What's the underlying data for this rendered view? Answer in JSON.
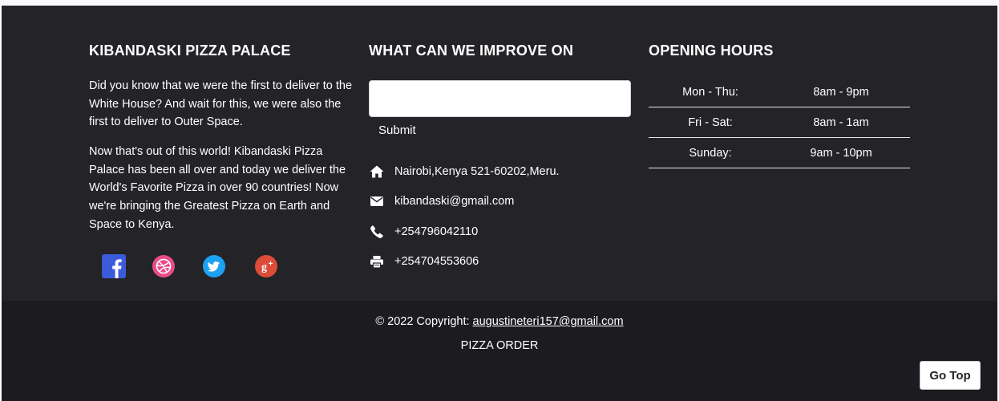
{
  "about": {
    "title": "KIBANDASKI PIZZA PALACE",
    "para1": "Did you know that we were the first to deliver to the White House? And wait for this, we were also the first to deliver to Outer Space.",
    "para2": "Now that's out of this world! Kibandaski Pizza Palace has been all over and today we deliver the World's Favorite Pizza in over 90 countries! Now we're bringing the Greatest Pizza on Earth and Space to Kenya.",
    "social": [
      {
        "icon": "facebook-icon",
        "color": "#3b5bdb"
      },
      {
        "icon": "dribbble-icon",
        "color": "#ea4c89"
      },
      {
        "icon": "twitter-icon",
        "color": "#1da1f2"
      },
      {
        "icon": "google-plus-icon",
        "color": "#dd4b39"
      }
    ]
  },
  "feedback": {
    "title": "WHAT CAN WE IMPROVE ON",
    "input_value": "",
    "submit_label": "Submit",
    "contacts": [
      {
        "icon": "home-icon",
        "text": "Nairobi,Kenya 521-60202,Meru."
      },
      {
        "icon": "envelope-icon",
        "text": "kibandaski@gmail.com"
      },
      {
        "icon": "phone-icon",
        "text": "+254796042110"
      },
      {
        "icon": "printer-icon",
        "text": "+254704553606"
      }
    ]
  },
  "hours": {
    "title": "OPENING HOURS",
    "rows": [
      {
        "day": "Mon - Thu:",
        "time": "8am - 9pm"
      },
      {
        "day": "Fri - Sat:",
        "time": "8am - 1am"
      },
      {
        "day": "Sunday:",
        "time": "9am - 10pm"
      }
    ]
  },
  "bottom": {
    "copyright_prefix": "© 2022 Copyright: ",
    "copyright_email": "augustineteri157@gmail.com",
    "brand": "PIZZA ORDER",
    "go_top_label": "Go Top"
  },
  "colors": {
    "footer_bg": "#242428",
    "footer_bottom_bg": "#1c1c20"
  }
}
